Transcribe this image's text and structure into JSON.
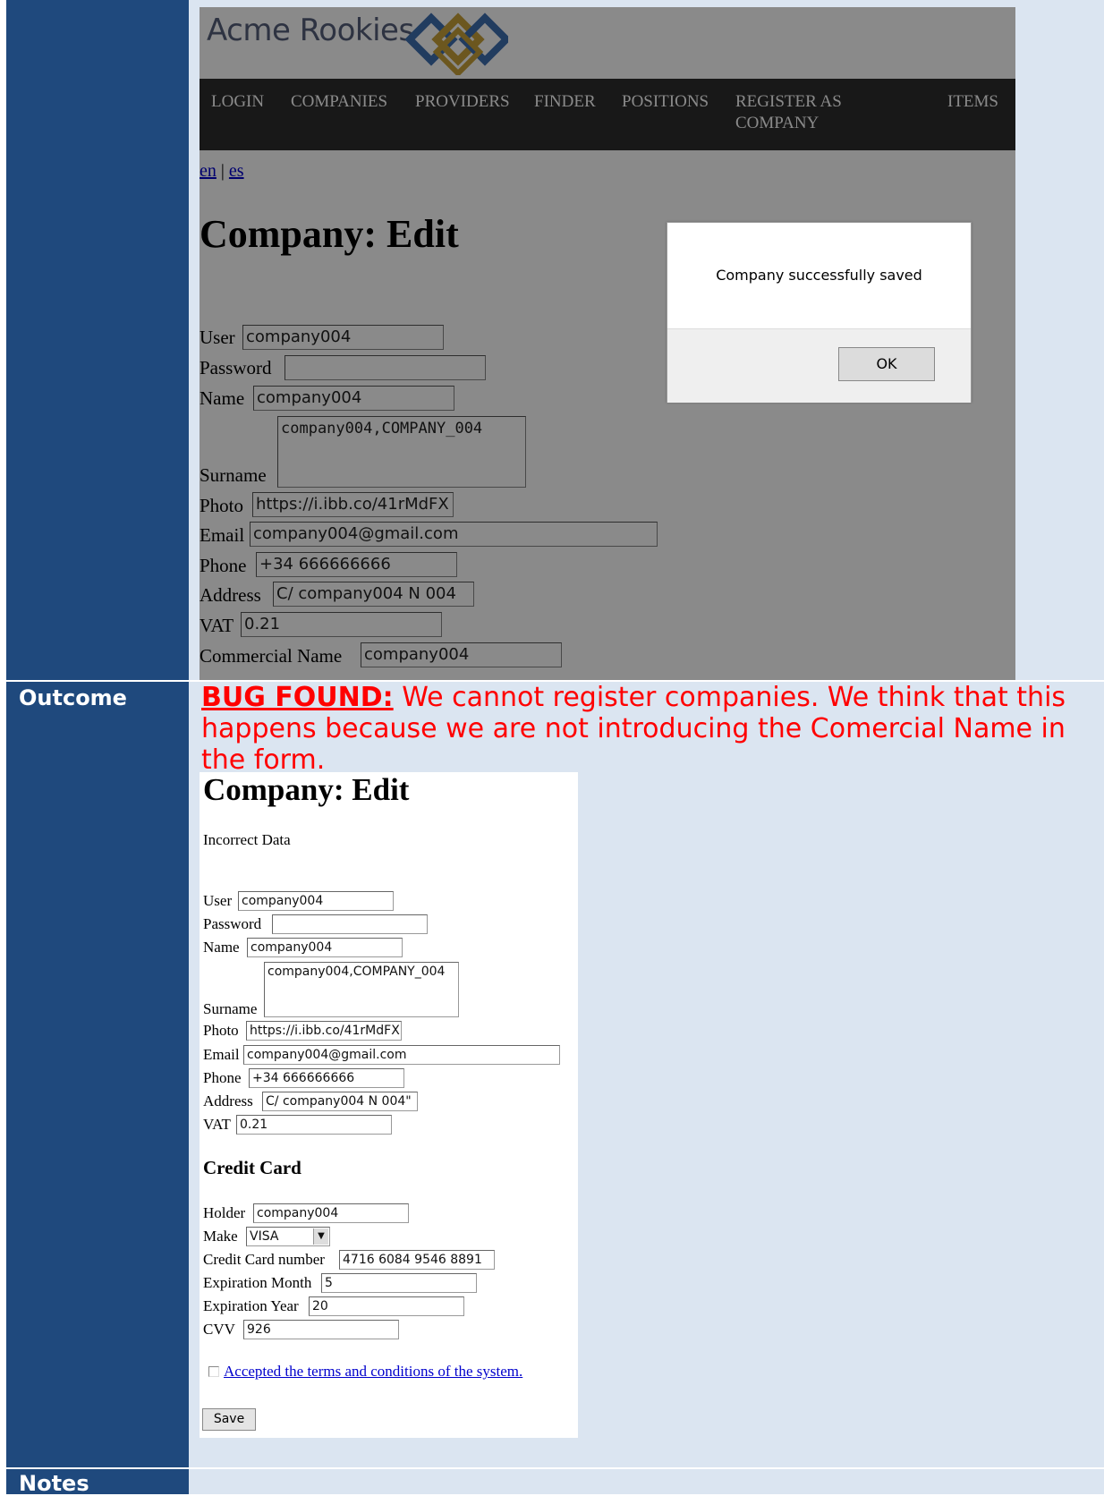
{
  "screenshot1": {
    "logo_text": "Acme Rookies",
    "nav": [
      "LOGIN",
      "COMPANIES",
      "PROVIDERS",
      "FINDER",
      "POSITIONS",
      "REGISTER AS COMPANY",
      "ITEMS"
    ],
    "lang_en": "en",
    "lang_sep": " | ",
    "lang_es": "es",
    "title": "Company: Edit",
    "fields": {
      "user_label": "User",
      "user_value": "company004",
      "password_label": "Password",
      "password_value": "",
      "name_label": "Name",
      "name_value": "company004",
      "surname_label": "Surname",
      "surname_value": "company004,COMPANY_004",
      "photo_label": "Photo",
      "photo_value": "https://i.ibb.co/41rMdFX",
      "email_label": "Email",
      "email_value": "company004@gmail.com",
      "phone_label": "Phone",
      "phone_value": "+34 666666666",
      "address_label": "Address",
      "address_value": "C/ company004 N 004",
      "vat_label": "VAT",
      "vat_value": "0.21",
      "commercial_label": "Commercial Name",
      "commercial_value": "company004"
    },
    "dialog": {
      "message": "Company successfully saved",
      "ok": "OK"
    }
  },
  "outcome": {
    "label": "Outcome",
    "bug_label": "BUG FOUND:",
    "text": " We cannot register companies. We think that this happens because we are not introducing the Comercial Name in the form."
  },
  "screenshot2": {
    "title": "Company: Edit",
    "error": "Incorrect Data",
    "fields": {
      "user_label": "User",
      "user_value": "company004",
      "password_label": "Password",
      "password_value": "",
      "name_label": "Name",
      "name_value": "company004",
      "surname_label": "Surname",
      "surname_value": "company004,COMPANY_004",
      "photo_label": "Photo",
      "photo_value": "https://i.ibb.co/41rMdFX",
      "email_label": "Email",
      "email_value": "company004@gmail.com",
      "phone_label": "Phone",
      "phone_value": "+34 666666666",
      "address_label": "Address",
      "address_value": "C/ company004 N 004\"",
      "vat_label": "VAT",
      "vat_value": "0.21"
    },
    "credit_card_title": "Credit Card",
    "cc": {
      "holder_label": "Holder",
      "holder_value": "company004",
      "make_label": "Make",
      "make_value": "VISA",
      "number_label": "Credit Card number",
      "number_value": "4716 6084 9546 8891",
      "month_label": "Expiration Month",
      "month_value": "5",
      "year_label": "Expiration Year",
      "year_value": "20",
      "cvv_label": "CVV",
      "cvv_value": "926"
    },
    "terms": "Accepted the terms and conditions of the system.",
    "save": "Save"
  },
  "notes": {
    "label": "Notes"
  }
}
